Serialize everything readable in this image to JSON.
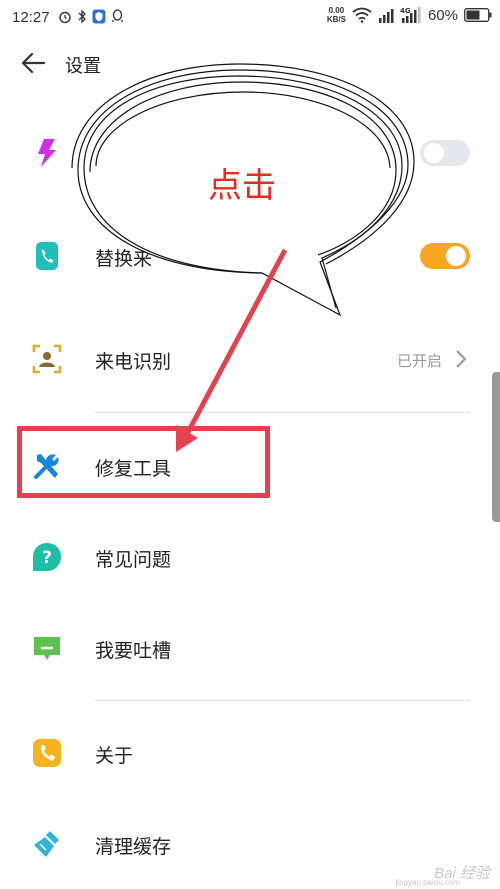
{
  "status_bar": {
    "time": "12:27",
    "speed_value": "0.00",
    "speed_unit": "KB/S",
    "network": "4G",
    "battery": "60%"
  },
  "header": {
    "title": "设置"
  },
  "settings": {
    "row1": {
      "label": "",
      "icon": "lightning-icon",
      "toggle": "off"
    },
    "row2": {
      "label": "替换来",
      "icon": "phone-icon",
      "toggle": "on"
    },
    "row3": {
      "label": "来电识别",
      "value": "已开启",
      "icon": "caller-id-icon"
    },
    "row4": {
      "label": "修复工具",
      "icon": "tools-icon"
    },
    "row5": {
      "label": "常见问题",
      "icon": "question-icon"
    },
    "row6": {
      "label": "我要吐槽",
      "icon": "feedback-icon"
    },
    "row7": {
      "label": "关于",
      "icon": "about-icon"
    },
    "row8": {
      "label": "清理缓存",
      "icon": "clean-icon"
    }
  },
  "annotation": {
    "bubble_text": "点击"
  },
  "watermark": {
    "text": "Bai 经验",
    "sub": "jingyan.baidu.com"
  },
  "colors": {
    "accent_orange": "#f5a623",
    "annotation_red": "#e2434e",
    "teal": "#1fbfb8"
  }
}
